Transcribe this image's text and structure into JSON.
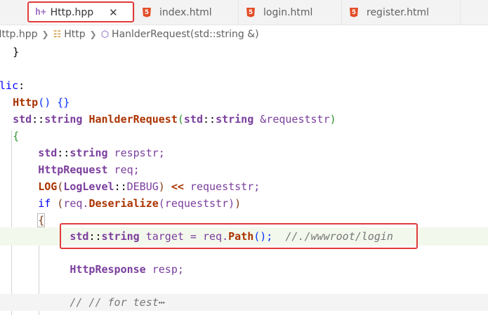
{
  "tabs": [
    {
      "label": "Http.hpp",
      "icon": "h-header-icon",
      "active": true
    },
    {
      "label": "index.html",
      "icon": "html5-icon",
      "active": false
    },
    {
      "label": "login.html",
      "icon": "html5-icon",
      "active": false
    },
    {
      "label": "register.html",
      "icon": "html5-icon",
      "active": false
    }
  ],
  "tab_icon_glyph": "h+",
  "html5_glyph": "5",
  "close_glyph": "✕",
  "breadcrumb": {
    "file": "Http.hpp",
    "class": "Http",
    "method": "HanlderRequest(std::string &)"
  },
  "code": {
    "l1": "}",
    "l2_kw": "blic",
    "l2_colon": ":",
    "l3_name": "Http",
    "l3_rest": "() {}",
    "l4_std": "std",
    "l4_ns": "::",
    "l4_type": "string",
    "l4_fn": "HanlderRequest",
    "l4_open": "(",
    "l4_std2": "std",
    "l4_ns2": "::",
    "l4_type2": "string",
    "l4_param": " &requeststr",
    "l4_close": ")",
    "l5": "{",
    "l6_std": "std",
    "l6_ns": "::",
    "l6_type": "string",
    "l6_var": " respstr;",
    "l7_type": "HttpRequest",
    "l7_var": " req;",
    "l8_macro": "LOG",
    "l8_open": "(",
    "l8_enum": "LogLevel",
    "l8_ns": "::",
    "l8_val": "DEBUG",
    "l8_close": ")",
    "l8_op": " <<",
    "l8_var": " requeststr;",
    "l9_kw": "if",
    "l9_open": " (",
    "l9_obj": "req.",
    "l9_fn": "Deserialize",
    "l9_args": "(requeststr)",
    "l9_close": ")",
    "l10": "{",
    "l11_std": "std",
    "l11_ns": "::",
    "l11_type": "string",
    "l11_var": " target = req.",
    "l11_fn": "Path",
    "l11_call": "();",
    "l11_comment": "  //./wwwroot/login",
    "l13_type": "HttpResponse",
    "l13_var": " resp;",
    "l15_comment": "// // for test",
    "l15_ellipsis": "⋯"
  },
  "colors": {
    "highlight_box": "#e03a3a",
    "active_tab_bg": "#ffffff",
    "tabbar_bg": "#f3f3f3"
  }
}
